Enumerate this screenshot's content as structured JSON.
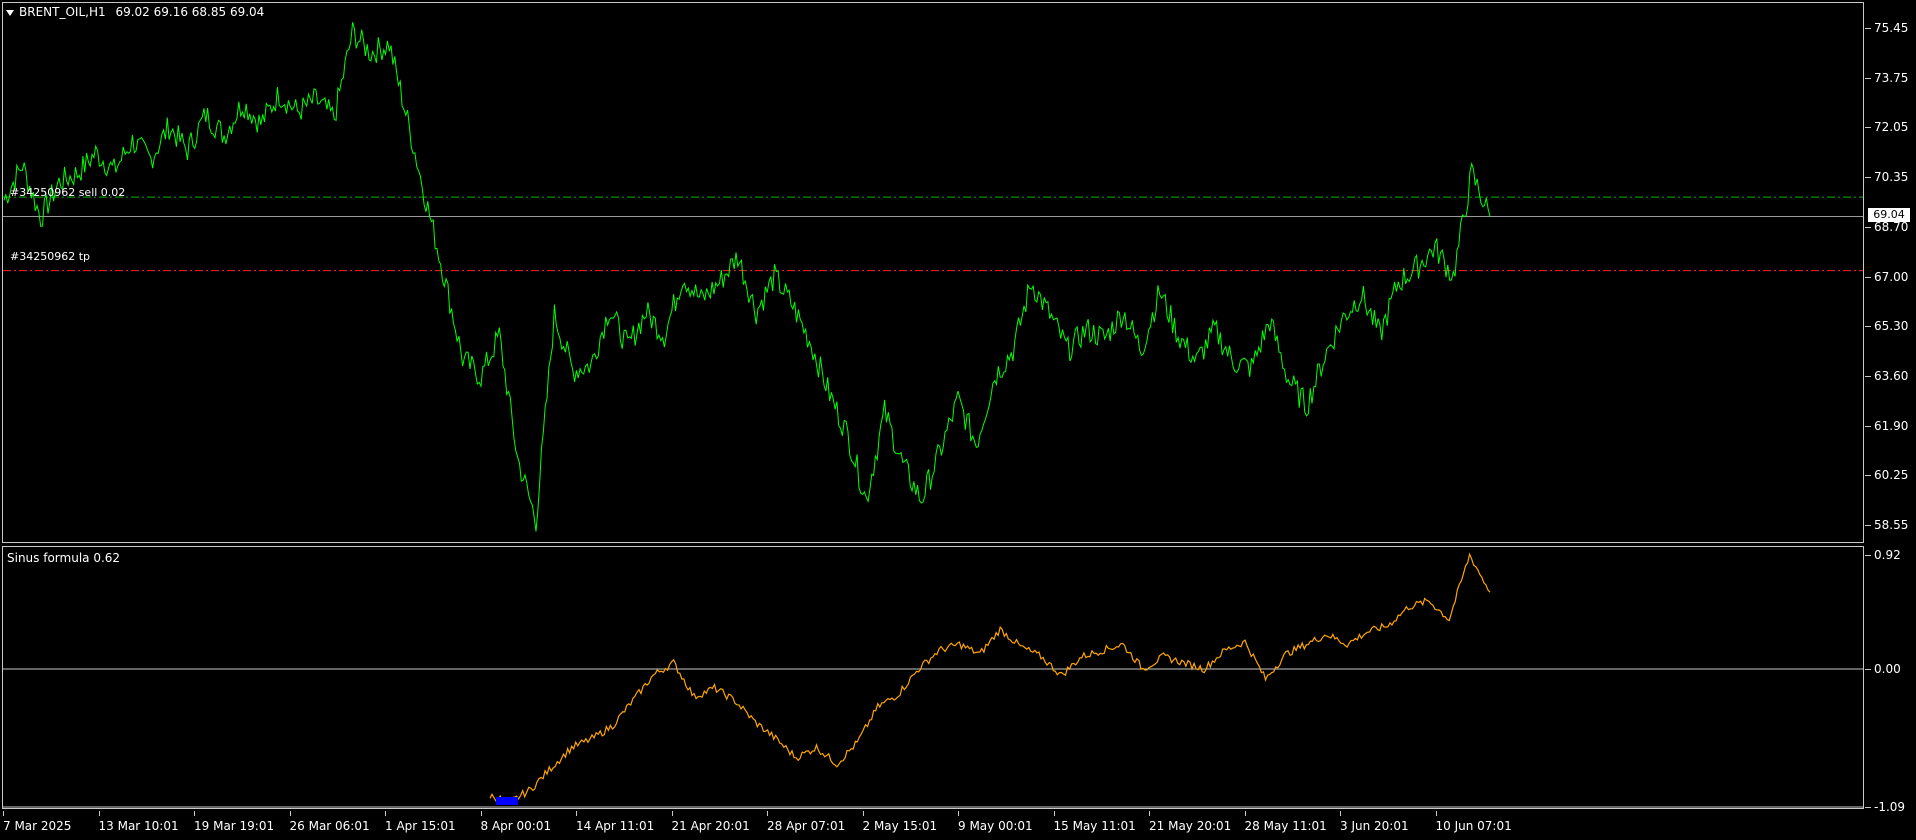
{
  "symbol_header": {
    "symbol": "BRENT_OIL,H1",
    "ohlc": "69.02 69.16 68.85 69.04"
  },
  "indicator_header": "Sinus formula 0.62",
  "orders": {
    "sell_label": "#34250962 sell 0.02",
    "tp_label": "#34250962 tp"
  },
  "current_price": "69.04",
  "price_axis": [
    "75.45",
    "73.75",
    "72.05",
    "70.35",
    "68.70",
    "67.00",
    "65.30",
    "63.60",
    "61.90",
    "60.25",
    "58.55"
  ],
  "indicator_axis": [
    "0.92",
    "0.00",
    "-1.09"
  ],
  "time_axis": [
    "7 Mar 2025",
    "13 Mar 10:01",
    "19 Mar 19:01",
    "26 Mar 06:01",
    "1 Apr 15:01",
    "8 Apr 00:01",
    "14 Apr 11:01",
    "21 Apr 20:01",
    "28 Apr 07:01",
    "2 May 15:01",
    "9 May 00:01",
    "15 May 11:01",
    "21 May 20:01",
    "28 May 11:01",
    "3 Jun 20:01",
    "10 Jun 07:01"
  ],
  "colors": {
    "price_line": "#00ff00",
    "indicator_line": "#ffa500",
    "sell_level": "#00b000",
    "tp_level": "#ff2020",
    "indicator_marker": "#0000ff",
    "grid": "#c8c8c8"
  },
  "chart_data": {
    "type": "line",
    "series": [
      {
        "pane": "main",
        "values": [
          69.6,
          70.8,
          69.0,
          70.2,
          70.5,
          71.2,
          70.6,
          71.6,
          71.0,
          72.1,
          71.3,
          72.5,
          71.8,
          72.9,
          72.2,
          73.2,
          72.6,
          73.0,
          72.4,
          75.3,
          74.6,
          74.9,
          72.3,
          69.6,
          67.0,
          64.2,
          63.6,
          65.0,
          60.8,
          58.7,
          65.7,
          63.8,
          64.0,
          65.9,
          64.6,
          65.8,
          65.0,
          67.0,
          66.2,
          66.8,
          67.7,
          65.8,
          67.0,
          66.0,
          64.7,
          63.0,
          61.6,
          59.4,
          62.4,
          60.6,
          59.4,
          61.0,
          62.8,
          61.3,
          63.6,
          64.5,
          66.8,
          65.7,
          64.5,
          65.2,
          64.9,
          65.8,
          64.5,
          66.5,
          65.0,
          64.1,
          65.2,
          64.1,
          63.9,
          65.5,
          63.5,
          62.6,
          64.3,
          65.6,
          66.4,
          65.0,
          66.8,
          67.3,
          68.0,
          67.0,
          70.5,
          69.04
        ],
        "x_range": [
          "7 Mar 2025",
          "10 Jun 07:01"
        ]
      },
      {
        "pane": "indicator",
        "values": [
          -1.0,
          -1.05,
          -0.95,
          -0.78,
          -0.62,
          -0.55,
          -0.45,
          -0.25,
          -0.05,
          0.05,
          -0.22,
          -0.15,
          -0.25,
          -0.42,
          -0.55,
          -0.7,
          -0.62,
          -0.75,
          -0.58,
          -0.3,
          -0.2,
          0.0,
          0.15,
          0.2,
          0.12,
          0.32,
          0.18,
          0.1,
          -0.05,
          0.1,
          0.15,
          0.2,
          0.0,
          0.1,
          0.05,
          0.0,
          0.15,
          0.22,
          -0.08,
          0.12,
          0.2,
          0.28,
          0.2,
          0.3,
          0.35,
          0.5,
          0.55,
          0.4,
          0.92,
          0.62
        ],
        "x_range": [
          "8 Apr 00:01",
          "10 Jun 07:01"
        ]
      }
    ],
    "price_levels": {
      "sell": 69.7,
      "tp": 67.2,
      "current": 69.04
    },
    "ylim_main": [
      58.0,
      76.0
    ],
    "ylim_indicator": [
      -1.09,
      1.02
    ],
    "grid": false
  }
}
